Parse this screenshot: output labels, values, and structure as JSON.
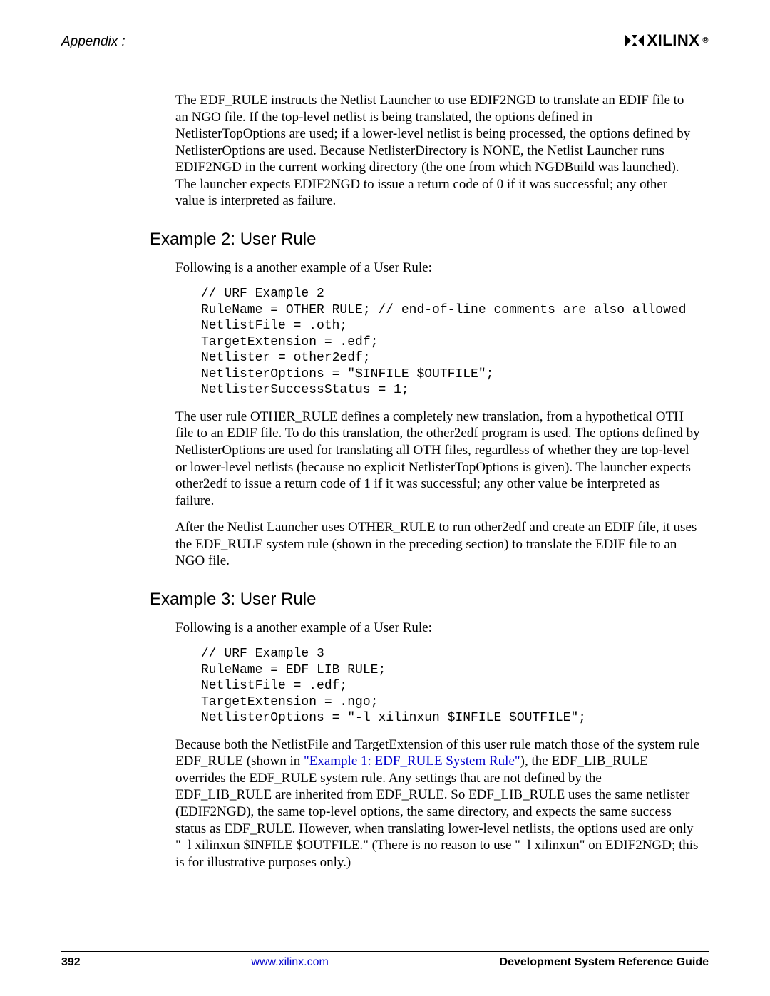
{
  "header": {
    "appendix": "Appendix :",
    "brand": "XILINX",
    "reg": "®"
  },
  "paragraphs": {
    "p1": "The EDF_RULE instructs the Netlist Launcher to use EDIF2NGD to translate an EDIF file to an NGO file. If the top-level netlist is being translated, the options defined in NetlisterTopOptions are used; if a lower-level netlist is being processed, the options defined by NetlisterOptions are used. Because NetlisterDirectory is NONE, the Netlist Launcher runs EDIF2NGD in the current working directory (the one from which NGDBuild was launched). The launcher expects EDIF2NGD to issue a return code of 0 if it was successful; any other value is interpreted as failure.",
    "p2_intro": "Following is a another example of a User Rule:",
    "p2_body": "The user rule OTHER_RULE defines a completely new translation, from a hypothetical OTH file to an EDIF file. To do this translation, the other2edf program is used. The options defined by NetlisterOptions are used for translating all OTH files, regardless of whether they are top-level or lower-level netlists (because no explicit NetlisterTopOptions is given). The launcher expects other2edf to issue a return code of 1 if it was successful; any other value be interpreted as failure.",
    "p2_body2": "After the Netlist Launcher uses OTHER_RULE to run other2edf and create an EDIF file, it uses the EDF_RULE system rule (shown in the preceding section) to translate the EDIF file to an NGO file.",
    "p3_intro": "Following is a another example of a User Rule:",
    "p3_body_before_link": "Because both the NetlistFile and TargetExtension of this user rule match those of the system rule EDF_RULE (shown in ",
    "p3_link": "\"Example 1: EDF_RULE System Rule\"",
    "p3_body_after_link": "), the EDF_LIB_RULE overrides the EDF_RULE system rule. Any settings that are not defined by the EDF_LIB_RULE are inherited from EDF_RULE. So EDF_LIB_RULE uses the same netlister (EDIF2NGD), the same top-level options, the same directory, and expects the same success status as EDF_RULE. However, when translating lower-level netlists, the options used are only \"–l xilinxun $INFILE $OUTFILE.\" (There is no reason to use \"–l xilinxun\" on EDIF2NGD; this is for illustrative purposes only.)"
  },
  "headings": {
    "ex2": "Example 2: User Rule",
    "ex3": "Example 3: User Rule"
  },
  "code": {
    "ex2": "// URF Example 2\nRuleName = OTHER_RULE; // end-of-line comments are also allowed\nNetlistFile = .oth;\nTargetExtension = .edf;\nNetlister = other2edf;\nNetlisterOptions = \"$INFILE $OUTFILE\";\nNetlisterSuccessStatus = 1;",
    "ex3": "// URF Example 3\nRuleName = EDF_LIB_RULE;\nNetlistFile = .edf;\nTargetExtension = .ngo;\nNetlisterOptions = \"-l xilinxun $INFILE $OUTFILE\";"
  },
  "footer": {
    "page": "392",
    "url": "www.xilinx.com",
    "guide": "Development System Reference Guide"
  }
}
